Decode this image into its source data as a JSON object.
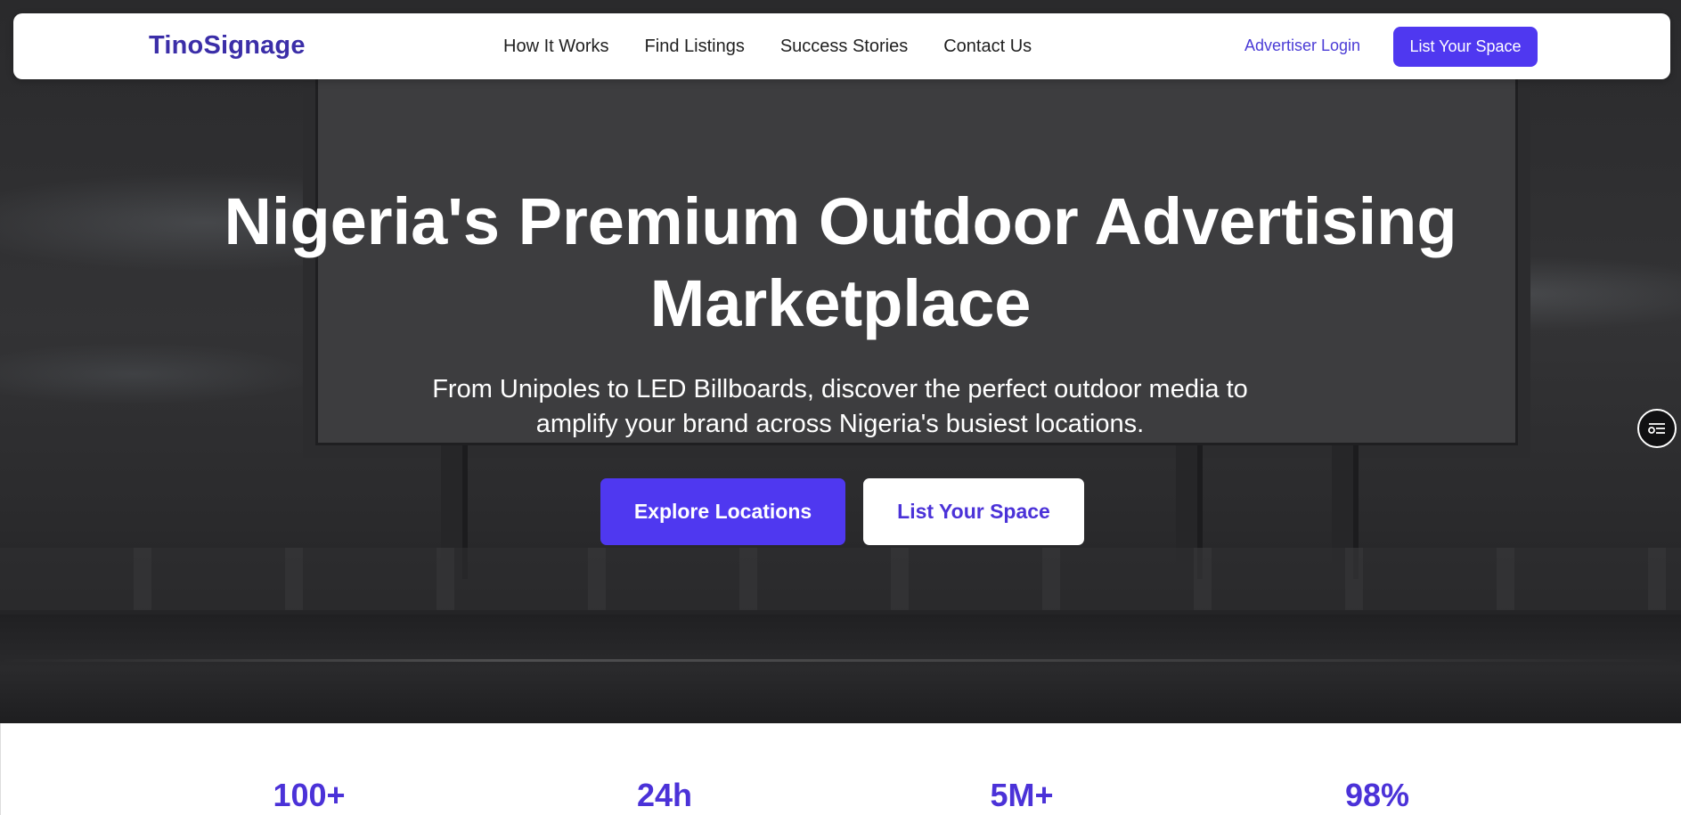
{
  "brand": {
    "logo_text": "TinoSignage",
    "accent_color": "#4f38f0",
    "logo_color": "#3b2ea8"
  },
  "nav": {
    "links": [
      {
        "label": "How It Works"
      },
      {
        "label": "Find Listings"
      },
      {
        "label": "Success Stories"
      },
      {
        "label": "Contact Us"
      }
    ],
    "login_label": "Advertiser Login",
    "cta_label": "List Your Space"
  },
  "hero": {
    "title_line1": "Nigeria's Premium Outdoor Advertising",
    "title_line2": "Marketplace",
    "subtitle_line1": "From Unipoles to LED Billboards, discover the perfect outdoor media to",
    "subtitle_line2": "amplify your brand across Nigeria's busiest locations.",
    "primary_button": "Explore Locations",
    "secondary_button": "List Your Space",
    "background_icon": "billboard-photo"
  },
  "side_widget": {
    "icon": "toggle-settings-icon"
  },
  "stats": [
    {
      "value": "100+"
    },
    {
      "value": "24h"
    },
    {
      "value": "5M+"
    },
    {
      "value": "98%"
    }
  ]
}
